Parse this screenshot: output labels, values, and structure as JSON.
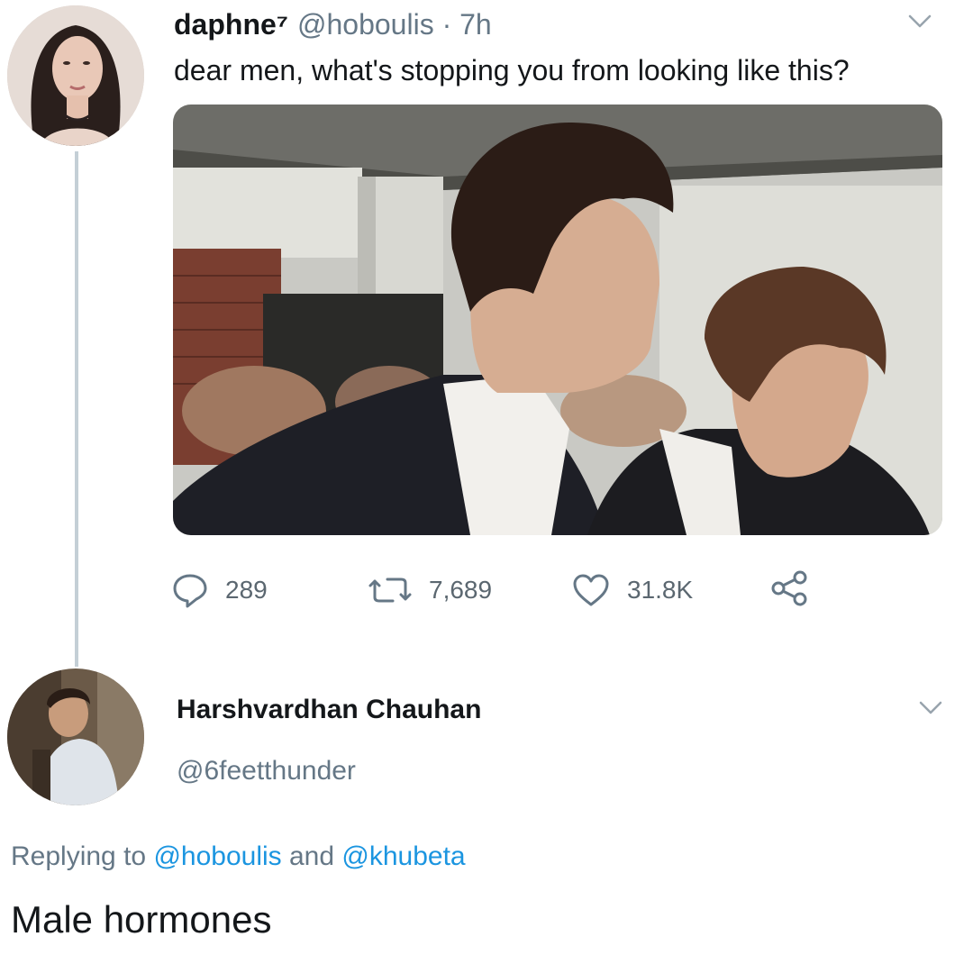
{
  "tweet": {
    "display_name": "daphne⁷",
    "handle": "@hoboulis",
    "separator": " · ",
    "time": "7h",
    "text": "dear men, what's stopping you from looking like this?",
    "actions": {
      "replies": "289",
      "retweets": "7,689",
      "likes": "31.8K"
    }
  },
  "reply": {
    "display_name": "Harshvardhan Chauhan",
    "handle": "@6feetthunder",
    "replying_prefix": "Replying to ",
    "replying_mention_1": "@hoboulis",
    "replying_and": " and ",
    "replying_mention_2": "@khubeta",
    "text": "Male hormones"
  },
  "icons": {
    "reply": "speech-bubble-icon",
    "retweet": "retweet-icon",
    "like": "heart-icon",
    "share": "share-icon",
    "more": "chevron-down-icon"
  },
  "colors": {
    "text_primary": "#14171a",
    "text_secondary": "#657786",
    "link": "#1b95e0",
    "thread_line": "#c4cfd6"
  }
}
